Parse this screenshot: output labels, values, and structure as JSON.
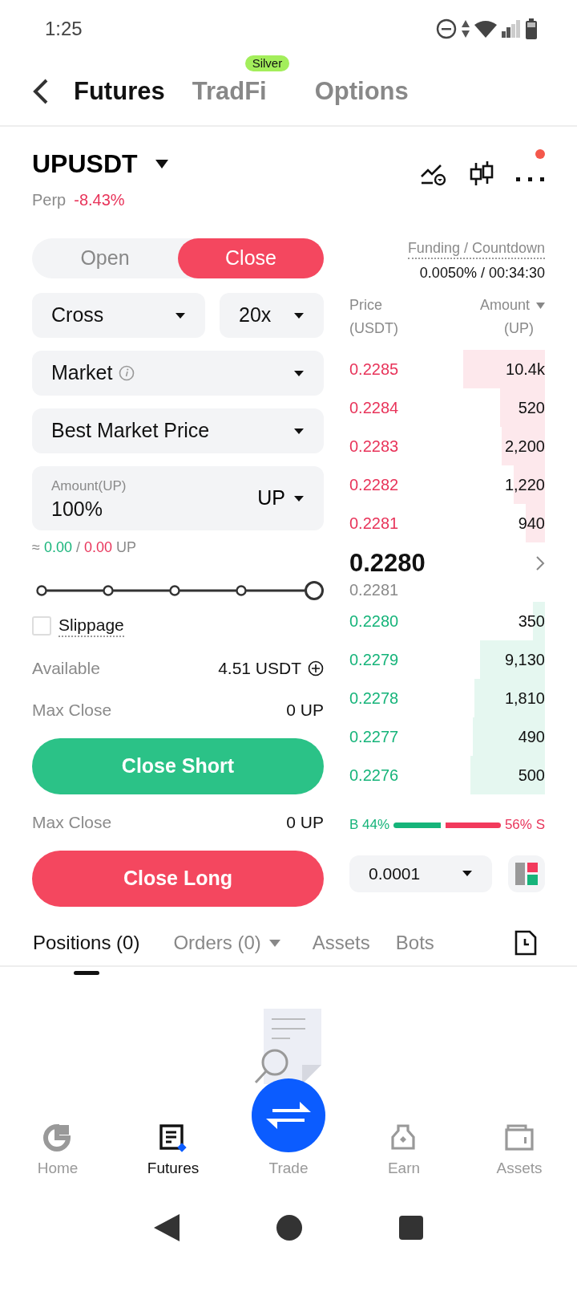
{
  "status_bar": {
    "time": "1:25"
  },
  "header": {
    "tabs": [
      {
        "label": "Futures",
        "selected": true
      },
      {
        "label": "TradFi",
        "selected": false,
        "badge": "Silver"
      },
      {
        "label": "Options",
        "selected": false
      }
    ]
  },
  "instrument": {
    "symbol": "UPUSDT",
    "type": "Perp",
    "change": "-8.43%",
    "menu_alert": true
  },
  "mode_toggle": [
    {
      "label": "Open",
      "selected": false
    },
    {
      "label": "Close",
      "selected": true
    }
  ],
  "margin_mode": "Cross",
  "leverage": "20x",
  "order_type": "Market",
  "price_type": "Best Market Price",
  "amount": {
    "label": "Amount(UP)",
    "value": "100%",
    "unit": "UP"
  },
  "estimate": {
    "prefix": "≈",
    "buy": "0.00",
    "separator": "/",
    "sell": "0.00",
    "unit": "UP"
  },
  "slippage": {
    "label": "Slippage",
    "checked": false
  },
  "available": {
    "label": "Available",
    "value": "4.51 USDT"
  },
  "actions": [
    {
      "max_label": "Max Close",
      "max_value": "0 UP",
      "button": "Close Short",
      "kind": "buy"
    },
    {
      "max_label": "Max Close",
      "max_value": "0 UP",
      "button": "Close Long",
      "kind": "sell"
    }
  ],
  "funding": {
    "label": "Funding / Countdown",
    "value": "0.0050% / 00:34:30"
  },
  "order_book": {
    "price_header": "Price",
    "price_unit": "(USDT)",
    "amount_header": "Amount",
    "amount_unit": "(UP)",
    "asks": [
      {
        "price": "0.2285",
        "amount": "10.4k"
      },
      {
        "price": "0.2284",
        "amount": "520"
      },
      {
        "price": "0.2283",
        "amount": "2,200"
      },
      {
        "price": "0.2282",
        "amount": "1,220"
      },
      {
        "price": "0.2281",
        "amount": "940"
      }
    ],
    "last_price": "0.2280",
    "mark_price": "0.2281",
    "bids": [
      {
        "price": "0.2280",
        "amount": "350"
      },
      {
        "price": "0.2279",
        "amount": "9,130"
      },
      {
        "price": "0.2278",
        "amount": "1,810"
      },
      {
        "price": "0.2277",
        "amount": "490"
      },
      {
        "price": "0.2276",
        "amount": "500"
      }
    ],
    "buy_label": "B 44%",
    "sell_label": "56% S",
    "precision": "0.0001"
  },
  "bottom_tabs": [
    {
      "label": "Positions (0)",
      "selected": true,
      "dropdown": false
    },
    {
      "label": "Orders (0)",
      "selected": false,
      "dropdown": true
    },
    {
      "label": "Assets",
      "selected": false,
      "dropdown": false
    },
    {
      "label": "Bots",
      "selected": false,
      "dropdown": false
    }
  ],
  "nav": [
    {
      "label": "Home",
      "kind": "home",
      "selected": false
    },
    {
      "label": "Futures",
      "kind": "futures",
      "selected": true
    },
    {
      "label": "Trade",
      "kind": "trade",
      "selected": false
    },
    {
      "label": "Earn",
      "kind": "earn",
      "selected": false
    },
    {
      "label": "Assets",
      "kind": "assets",
      "selected": false
    }
  ]
}
